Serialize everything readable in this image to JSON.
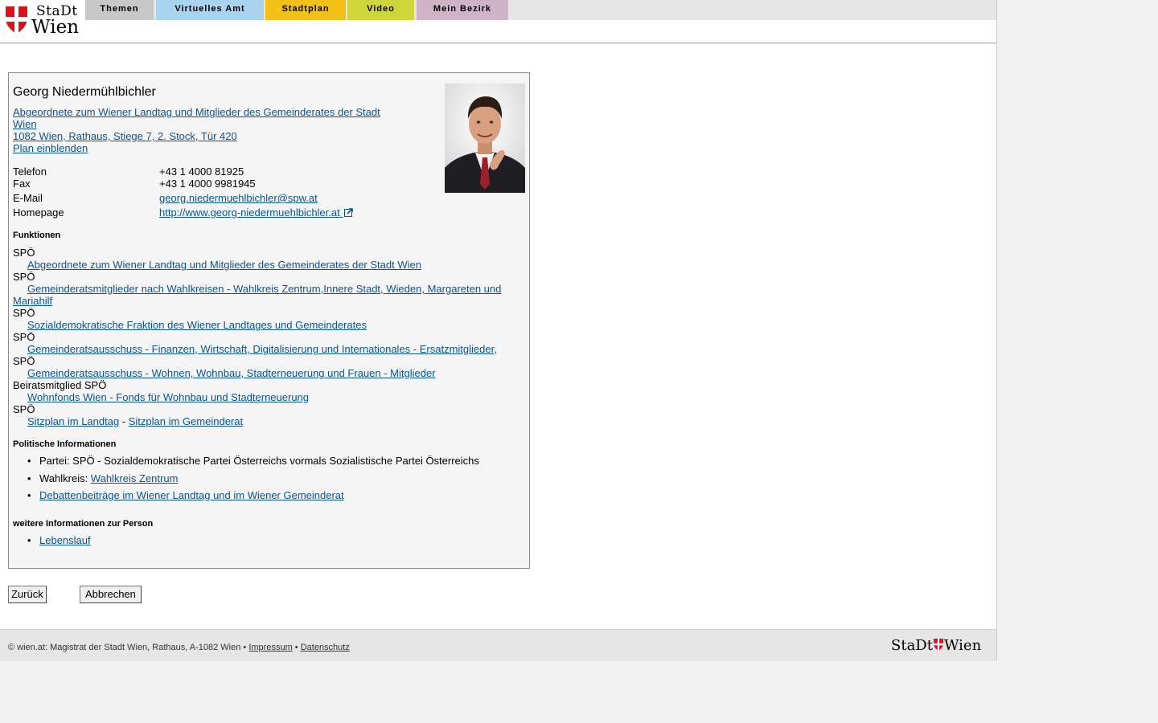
{
  "brand": {
    "line1": "StaDt",
    "line2": "Wien"
  },
  "nav": {
    "tabs": [
      {
        "label": "Themen",
        "color": "#c8c8c8"
      },
      {
        "label": "Virtuelles Amt",
        "color": "#a9d4f0"
      },
      {
        "label": "Stadtplan",
        "color": "#f3c018"
      },
      {
        "label": "Video",
        "color": "#cfd63a"
      },
      {
        "label": "Mein Bezirk",
        "color": "#cfb3c6"
      }
    ]
  },
  "person": {
    "name": "Georg Niedermühlbichler",
    "role_line1": "Abgeordnete zum Wiener Landtag und Mitglieder des Gemeinderates der Stadt",
    "role_line2": "Wien",
    "address": "1082 Wien, Rathaus, Stiege 7, 2. Stock, Tür 420",
    "plan_link": "Plan einblenden",
    "contacts": [
      {
        "label": "Telefon",
        "value": "+43 1 4000 81925"
      },
      {
        "label": "Fax",
        "value": "+43 1 4000 9981945"
      },
      {
        "label": "E-Mail",
        "value": "georg.niedermuehlbichler@spw.at"
      },
      {
        "label": "Homepage",
        "value": "http://www.georg-niedermuehlbichler.at"
      }
    ]
  },
  "funktionen": {
    "heading": "Funktionen",
    "items": [
      {
        "party": "SPÖ",
        "link": "Abgeordnete zum Wiener Landtag und Mitglieder des Gemeinderates der Stadt Wien"
      },
      {
        "party": "SPÖ",
        "link": "Gemeinderatsmitglieder nach Wahlkreisen - Wahlkreis Zentrum,Innere Stadt, Wieden, Margareten und",
        "link2": "Mariahilf"
      },
      {
        "party": "SPÖ",
        "link": "Sozialdemokratische Fraktion des Wiener Landtages und Gemeinderates"
      },
      {
        "party": "SPÖ",
        "link": "Gemeinderatsausschuss - Finanzen, Wirtschaft, Digitalisierung und Internationales - Ersatzmitglieder, "
      },
      {
        "party": "SPÖ",
        "link": "Gemeinderatsausschuss - Wohnen, Wohnbau, Stadterneuerung und Frauen - Mitglieder"
      },
      {
        "party": "Beiratsmitglied SPÖ",
        "link": "Wohnfonds Wien - Fonds für Wohnbau und Stadterneuerung"
      },
      {
        "party": "SPÖ"
      }
    ],
    "sitzplan_landtag": "Sitzplan im Landtag",
    "sitzplan_sep": " - ",
    "sitzplan_gemeinderat": "Sitzplan im Gemeinderat"
  },
  "politik": {
    "heading": "Politische Informationen",
    "partei": "Partei: SPÖ - Sozialdemokratische Partei Österreichs vormals Sozialistische Partei Österreichs",
    "wahlkreis_label": "Wahlkreis: ",
    "wahlkreis_link": "Wahlkreis Zentrum",
    "debatten": "Debattenbeiträge im Wiener Landtag und im Wiener Gemeinderat"
  },
  "weitere": {
    "heading": "weitere Informationen zur Person",
    "lebenslauf": "Lebenslauf"
  },
  "buttons": {
    "back": "Zurück",
    "cancel": "Abbrechen"
  },
  "footer": {
    "text": "© wien.at: Magistrat der Stadt Wien, Rathaus, A-1082 Wien • ",
    "impressum": "Impressum",
    "sep": " • ",
    "datenschutz": "Datenschutz",
    "logo_left": "StaDt",
    "logo_right": "Wien"
  }
}
